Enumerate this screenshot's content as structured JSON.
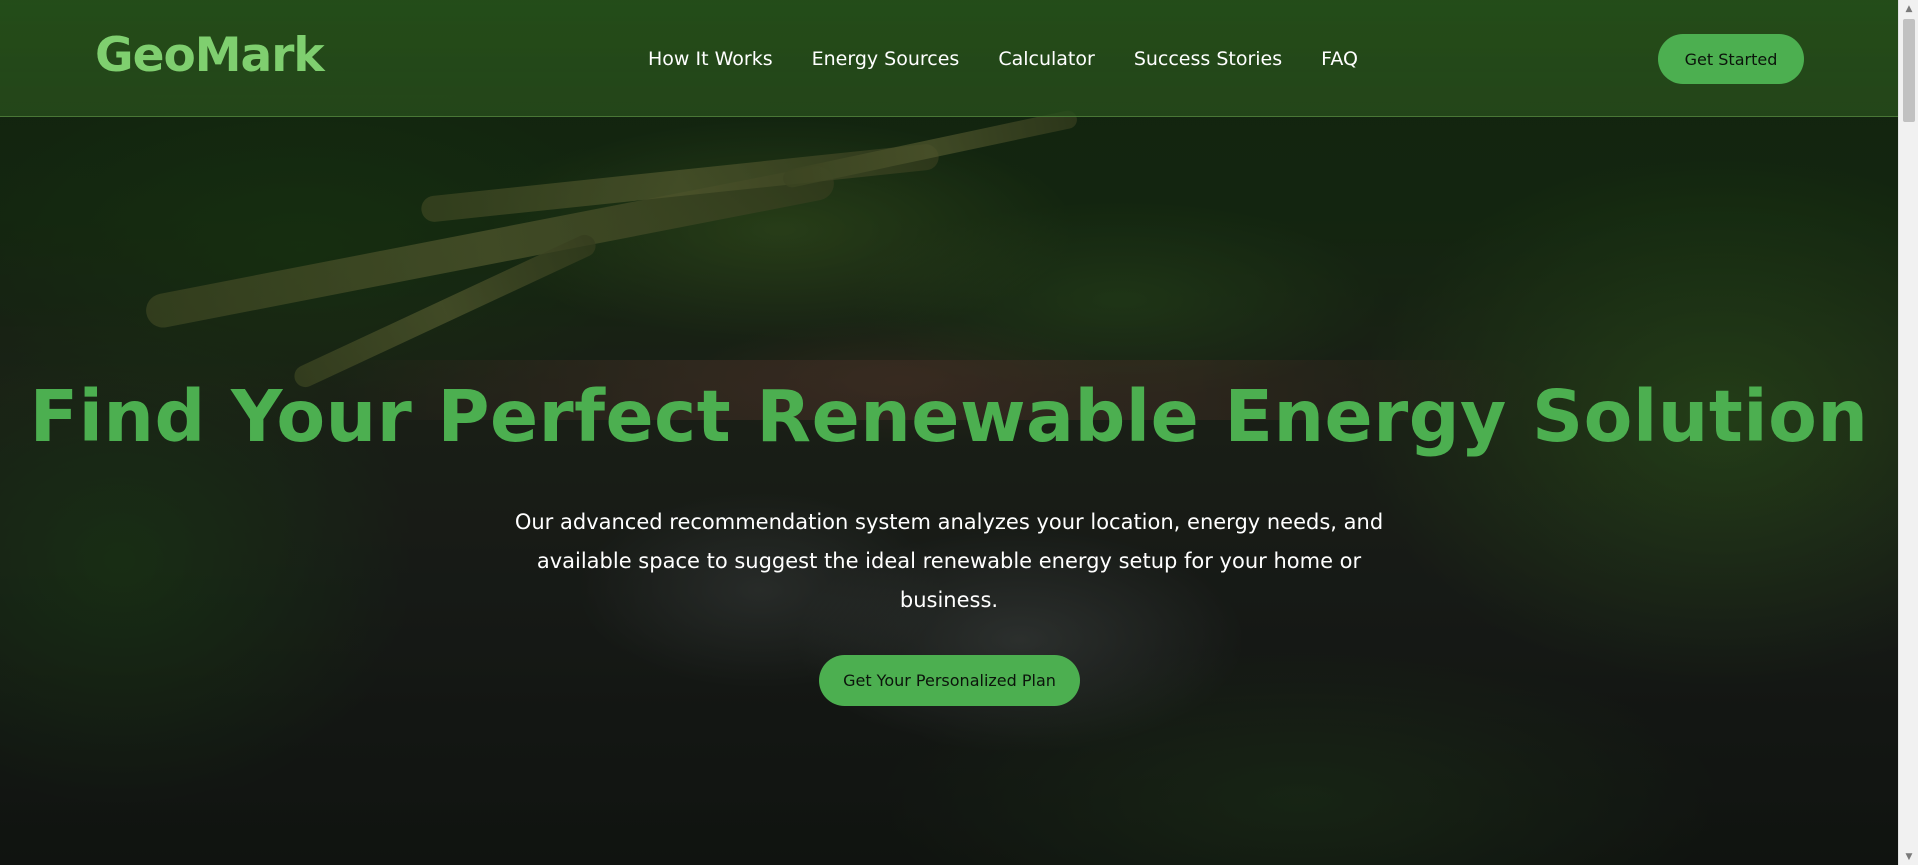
{
  "header": {
    "logo": "GeoMark",
    "nav": [
      {
        "label": "How It Works"
      },
      {
        "label": "Energy Sources"
      },
      {
        "label": "Calculator"
      },
      {
        "label": "Success Stories"
      },
      {
        "label": "FAQ"
      }
    ],
    "cta_label": "Get Started"
  },
  "hero": {
    "title": "Find Your Perfect Renewable Energy Solution",
    "subtitle": "Our advanced recommendation system analyzes your location, energy needs, and available space to suggest the ideal renewable energy setup for your home or business.",
    "cta_label": "Get Your Personalized Plan",
    "background_description_icon": "forest-waterfall-image"
  },
  "colors": {
    "accent": "#4caf50",
    "logo": "#7fcf6f",
    "header_bg": "#2a5520"
  },
  "scrollbar": {
    "up_icon": "chevron-up-icon",
    "down_icon": "chevron-down-icon"
  }
}
